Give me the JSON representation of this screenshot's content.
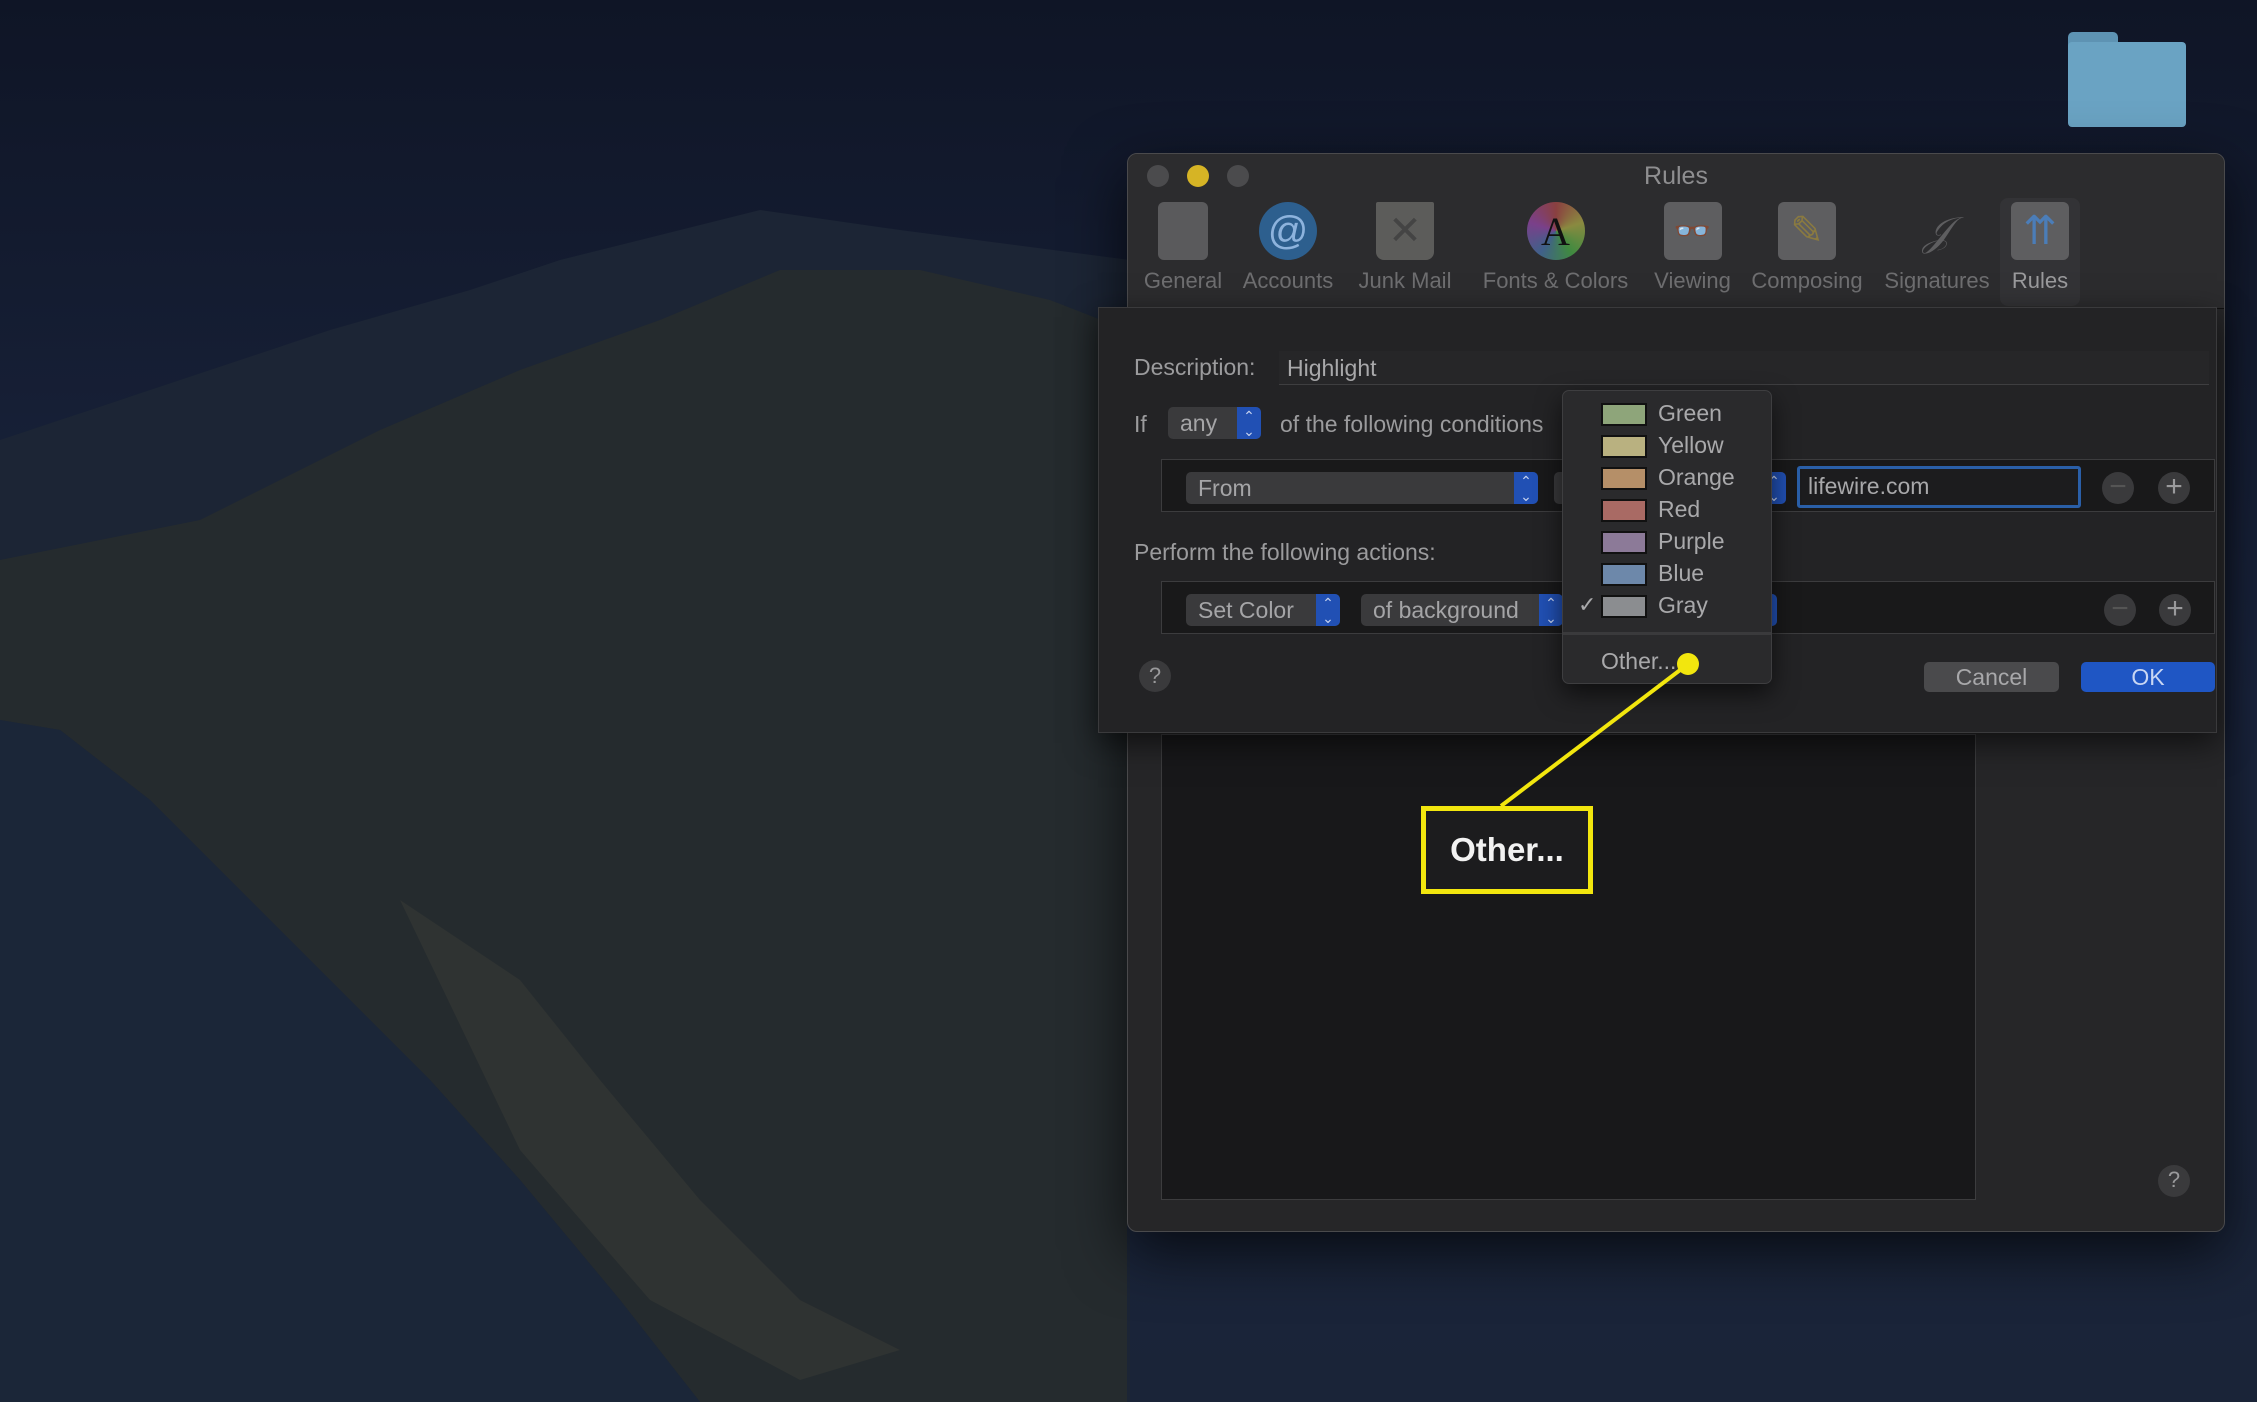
{
  "window": {
    "title": "Rules"
  },
  "toolbar": [
    {
      "label": "General",
      "icon": "general-switch-icon"
    },
    {
      "label": "Accounts",
      "icon": "at-sign-icon"
    },
    {
      "label": "Junk Mail",
      "icon": "trash-icon"
    },
    {
      "label": "Fonts & Colors",
      "icon": "color-wheel-icon"
    },
    {
      "label": "Viewing",
      "icon": "glasses-icon"
    },
    {
      "label": "Composing",
      "icon": "pencil-icon"
    },
    {
      "label": "Signatures",
      "icon": "signature-icon"
    },
    {
      "label": "Rules",
      "icon": "rules-envelope-icon"
    }
  ],
  "rule": {
    "description_label": "Description:",
    "description_value": "Highlight",
    "if_label": "If",
    "any_value": "any",
    "conditions_text": "of the following conditions",
    "condition_field": "From",
    "condition_value": "lifewire.com",
    "actions_label": "Perform the following actions:",
    "action": "Set Color",
    "action_target": "of background",
    "help": "?",
    "cancel": "Cancel",
    "ok": "OK"
  },
  "color_menu": {
    "items": [
      {
        "label": "Green",
        "color": "#8ea57a"
      },
      {
        "label": "Yellow",
        "color": "#b9b180"
      },
      {
        "label": "Orange",
        "color": "#b58f68"
      },
      {
        "label": "Red",
        "color": "#a96a64"
      },
      {
        "label": "Purple",
        "color": "#8c7a98"
      },
      {
        "label": "Blue",
        "color": "#6d88aa"
      },
      {
        "label": "Gray",
        "color": "#8b8d90"
      }
    ],
    "selected": "Gray",
    "check": "✓",
    "other": "Other..."
  },
  "callout": {
    "text": "Other...",
    "color": "#f2e60e"
  },
  "bottom_help": "?"
}
